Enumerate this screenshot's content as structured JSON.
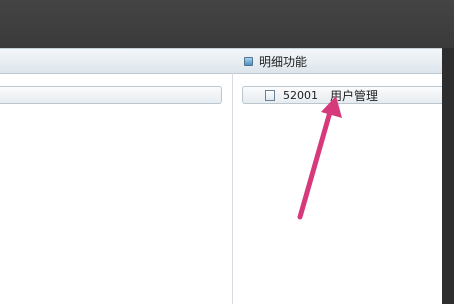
{
  "detail_panel": {
    "title": "明细功能",
    "items": [
      {
        "code": "52001",
        "name": "用户管理"
      }
    ]
  },
  "colors": {
    "annotation_arrow": "#d63a7a",
    "section_bar": "#dde5eb",
    "window_bg": "#ffffff",
    "backdrop": "#3c3c3c"
  },
  "icons": {
    "section_marker": "square-bullet-icon",
    "item_marker": "document-icon"
  }
}
